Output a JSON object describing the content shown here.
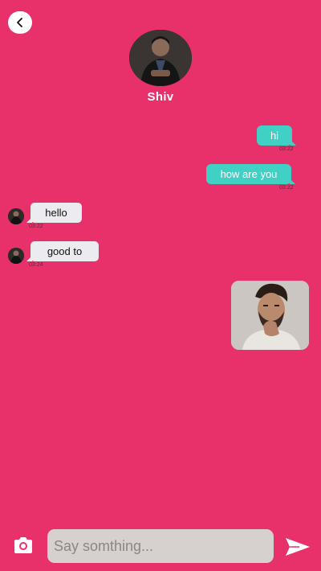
{
  "contact": {
    "name": "Shiv"
  },
  "messages": [
    {
      "direction": "out",
      "text": "hi",
      "time": "03:22"
    },
    {
      "direction": "out",
      "text": "how are you",
      "time": "03:22"
    },
    {
      "direction": "in",
      "text": "hello",
      "time": "03:22"
    },
    {
      "direction": "in",
      "text": "good to",
      "time": "03:24"
    },
    {
      "direction": "out",
      "type": "image",
      "text": ""
    }
  ],
  "composer": {
    "placeholder": "Say somthing..."
  },
  "colors": {
    "background": "#e8306a",
    "outgoing_bubble": "#40d0c4",
    "incoming_bubble": "#ebebf0",
    "input_background": "#d6d1cf"
  },
  "icons": {
    "back": "back-arrow-icon",
    "camera": "camera-icon",
    "send": "send-icon"
  }
}
